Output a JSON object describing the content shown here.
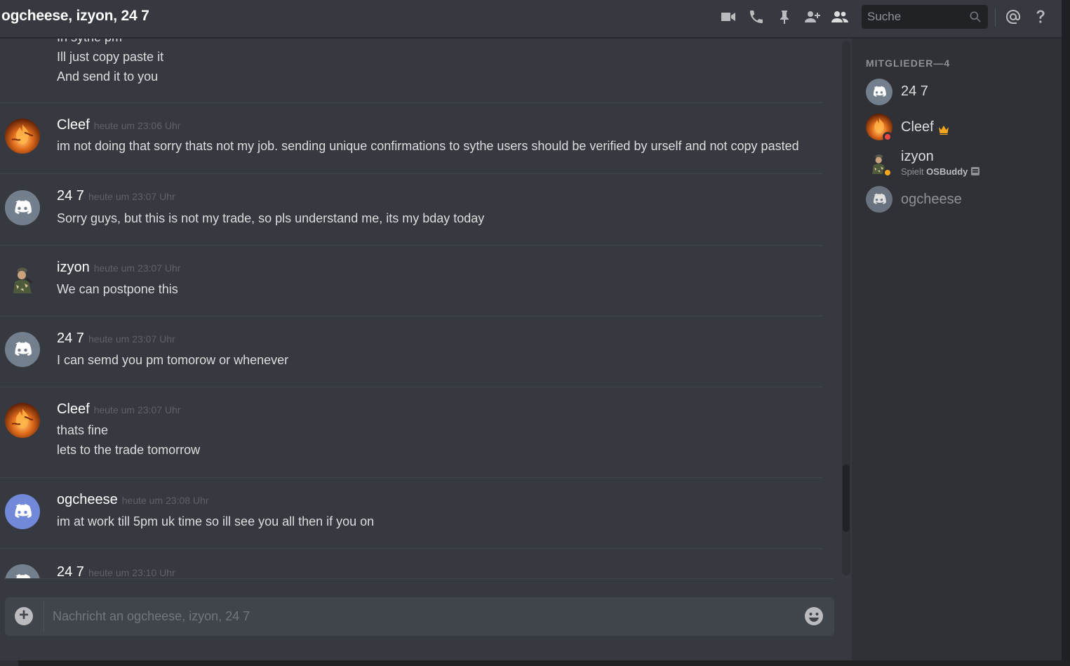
{
  "header": {
    "title": "ogcheese, izyon, 24 7",
    "icons": [
      "video-call-icon",
      "voice-call-icon",
      "pin-icon",
      "add-member-icon",
      "member-list-icon",
      "mention-icon",
      "help-icon"
    ],
    "search": {
      "placeholder": "Suche"
    }
  },
  "messages": {
    "partial_group": {
      "cut_line": "In sythe pm",
      "lines": [
        "Ill just copy paste it",
        "And send it to you"
      ]
    },
    "groups": [
      {
        "author": "Cleef",
        "timestamp": "heute um 23:06 Uhr",
        "avatar": "cleef-avatar-icon",
        "lines": [
          "im not doing that sorry thats not my job. sending unique confirmations to sythe users should be verified by urself and not copy pasted"
        ]
      },
      {
        "author": "24 7",
        "timestamp": "heute um 23:07 Uhr",
        "avatar": "discord-default-avatar-icon",
        "lines": [
          "Sorry guys, but this is not my trade, so pls understand me, its my bday today"
        ]
      },
      {
        "author": "izyon",
        "timestamp": "heute um 23:07 Uhr",
        "avatar": "izyon-avatar-icon",
        "lines": [
          "We can postpone this"
        ]
      },
      {
        "author": "24 7",
        "timestamp": "heute um 23:07 Uhr",
        "avatar": "discord-default-avatar-icon",
        "lines": [
          "I can semd you pm tomorow or whenever"
        ]
      },
      {
        "author": "Cleef",
        "timestamp": "heute um 23:07 Uhr",
        "avatar": "cleef-avatar-icon",
        "lines": [
          "thats fine",
          "lets to the trade tomorrow"
        ]
      },
      {
        "author": "ogcheese",
        "timestamp": "heute um 23:08 Uhr",
        "avatar": "discord-blurple-avatar-icon",
        "lines": [
          "im at work till 5pm uk time so ill see you all then if you on"
        ]
      },
      {
        "author": "24 7",
        "timestamp": "heute um 23:10 Uhr",
        "avatar": "discord-default-avatar-icon",
        "lines": []
      }
    ]
  },
  "composer": {
    "placeholder": "Nachricht an ogcheese, izyon, 24 7"
  },
  "members": {
    "header": "MITGLIEDER—4",
    "list": [
      {
        "name": "24 7",
        "status": "none"
      },
      {
        "name": "Cleef",
        "status": "dnd",
        "owner": true
      },
      {
        "name": "izyon",
        "status": "idle",
        "activity_prefix": "Spielt",
        "activity_game": "OSBuddy"
      },
      {
        "name": "ogcheese",
        "status": "offline"
      }
    ]
  },
  "colors": {
    "background": "#36393f",
    "sidebar": "#2f3136",
    "blurple": "#7289da",
    "grey_avatar": "#747f8d",
    "dnd": "#f04747",
    "idle": "#faa61a",
    "crown": "#faa61a"
  }
}
